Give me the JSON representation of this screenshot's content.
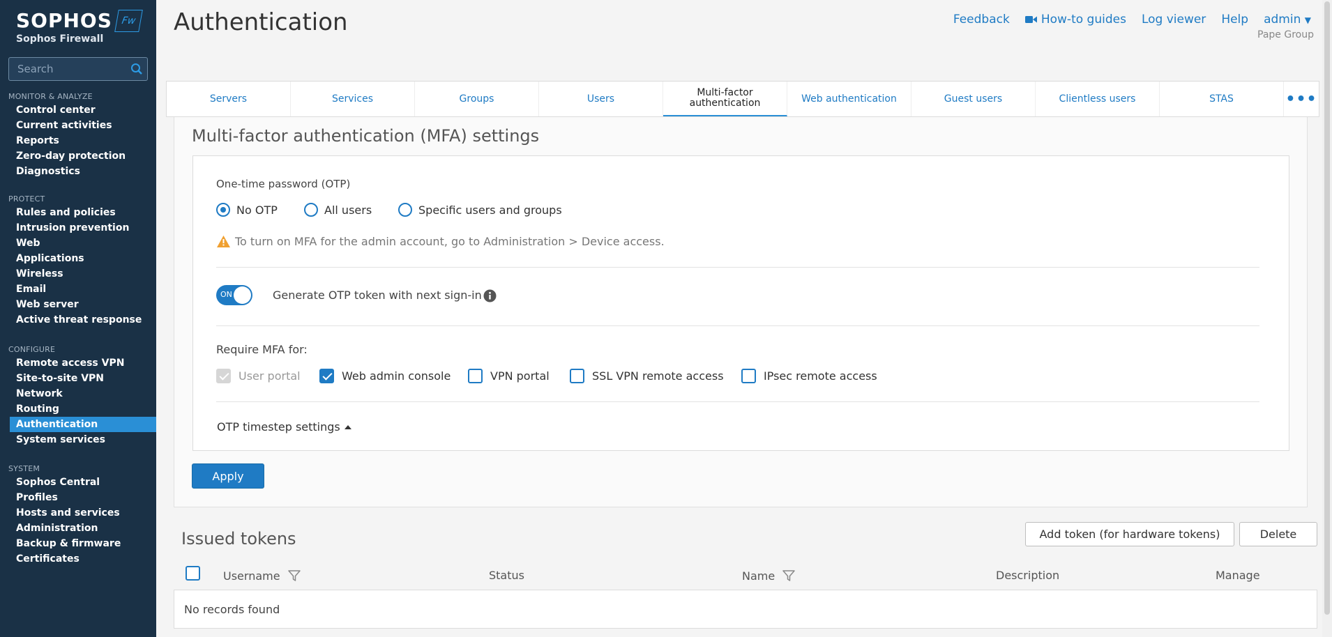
{
  "sidebar": {
    "logo_text": "SOPHOS",
    "logo_badge": "Fw",
    "product": "Sophos Firewall",
    "search_placeholder": "Search",
    "sections": [
      {
        "heading": "MONITOR & ANALYZE",
        "items": [
          "Control center",
          "Current activities",
          "Reports",
          "Zero-day protection",
          "Diagnostics"
        ]
      },
      {
        "heading": "PROTECT",
        "items": [
          "Rules and policies",
          "Intrusion prevention",
          "Web",
          "Applications",
          "Wireless",
          "Email",
          "Web server",
          "Active threat response"
        ]
      },
      {
        "heading": "CONFIGURE",
        "items": [
          "Remote access VPN",
          "Site-to-site VPN",
          "Network",
          "Routing",
          "Authentication",
          "System services"
        ]
      },
      {
        "heading": "SYSTEM",
        "items": [
          "Sophos Central",
          "Profiles",
          "Hosts and services",
          "Administration",
          "Backup & firmware",
          "Certificates"
        ]
      }
    ],
    "active_item": "Authentication"
  },
  "header": {
    "title": "Authentication",
    "links": {
      "feedback": "Feedback",
      "howto": "How-to guides",
      "logviewer": "Log viewer",
      "help": "Help",
      "user": "admin"
    },
    "org": "Pape Group"
  },
  "tabs": [
    "Servers",
    "Services",
    "Groups",
    "Users",
    "Multi-factor authentication",
    "Web authentication",
    "Guest users",
    "Clientless users",
    "STAS"
  ],
  "tab_more": "•••",
  "active_tab": "Multi-factor authentication",
  "mfa": {
    "section_title": "Multi-factor authentication (MFA) settings",
    "otp_label": "One-time password (OTP)",
    "otp_options": [
      "No OTP",
      "All users",
      "Specific users and groups"
    ],
    "otp_selected": "No OTP",
    "warning": "To turn on MFA for the admin account, go to Administration > Device access.",
    "toggle_state": "ON",
    "toggle_label": "Generate OTP token with next sign-in",
    "require_label": "Require MFA for:",
    "require_options": [
      {
        "label": "User portal",
        "state": "disabled-checked"
      },
      {
        "label": "Web admin console",
        "state": "checked"
      },
      {
        "label": "VPN portal",
        "state": "unchecked"
      },
      {
        "label": "SSL VPN remote access",
        "state": "unchecked"
      },
      {
        "label": "IPsec remote access",
        "state": "unchecked"
      }
    ],
    "timestep_label": "OTP timestep settings",
    "apply_label": "Apply"
  },
  "tokens": {
    "title": "Issued tokens",
    "add_button": "Add token (for hardware tokens)",
    "delete_button": "Delete",
    "columns": [
      "Username",
      "Status",
      "Name",
      "Description",
      "Manage"
    ],
    "empty_text": "No records found"
  },
  "colors": {
    "sidebar_bg": "#1a3146",
    "accent": "#1f7bc4",
    "active_nav": "#2a8fd6",
    "warning": "#f0a030"
  }
}
